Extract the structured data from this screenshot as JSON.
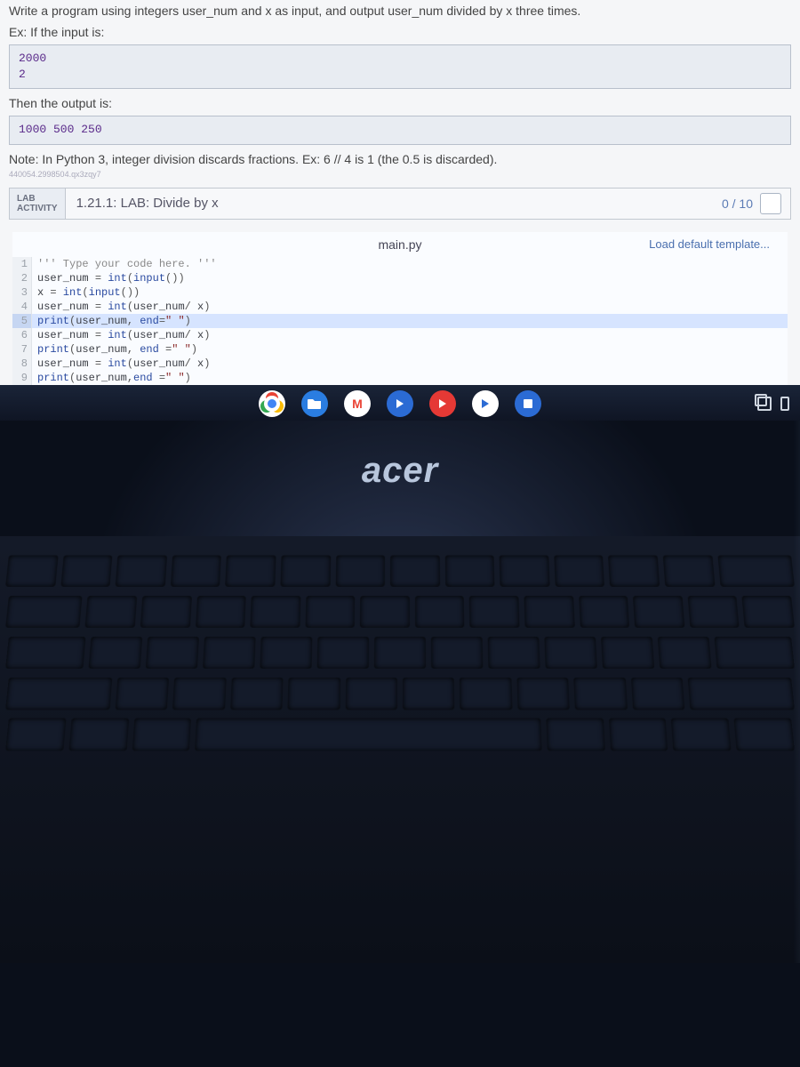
{
  "problem": {
    "instruction": "Write a program using integers user_num and x as input, and output user_num divided by x three times.",
    "example_intro": "Ex: If the input is:",
    "example_input": "2000\n2",
    "output_intro": "Then the output is:",
    "example_output": "1000 500 250",
    "note": "Note: In Python 3, integer division discards fractions. Ex: 6 // 4 is 1 (the 0.5 is discarded).",
    "small_id": "440054.2998504.qx3zqy7"
  },
  "lab": {
    "badge1": "LAB",
    "badge2": "ACTIVITY",
    "title": "1.21.1: LAB: Divide by x",
    "score": "0 / 10"
  },
  "editor": {
    "filename": "main.py",
    "load_template": "Load default template...",
    "lines": [
      "''' Type your code here. '''",
      "user_num = int(input())",
      "x = int(input())",
      "user_num = int(user_num/ x)",
      "print(user_num, end=\" \")",
      "user_num = int(user_num/ x)",
      "print(user_num, end =\" \")",
      "user_num = int(user_num/ x)",
      "print(user_num,end =\" \")"
    ],
    "highlight_line": 5
  },
  "shelf": {
    "chrome": "chrome-icon",
    "files": "files-icon",
    "gmail": "M",
    "app1": "app-icon",
    "app2": "play-icon",
    "app3": "play-icon-2",
    "app4": "app-icon-2"
  },
  "laptop": {
    "brand": "acer"
  }
}
